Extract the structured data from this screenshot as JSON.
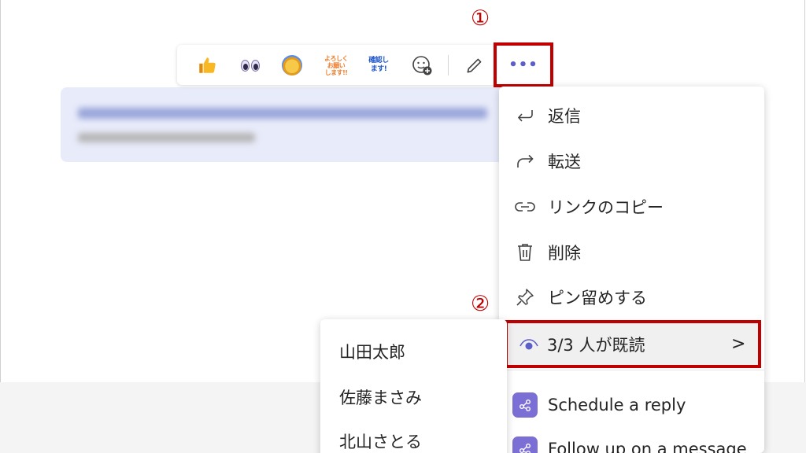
{
  "annotations": {
    "step1": "①",
    "step2": "②"
  },
  "reactions": {
    "thumb_icon": "thumbs-up-icon",
    "eyes_icon": "eyes-icon",
    "lion_icon": "lion-icon",
    "sticker_yoroshiku": "よろしく お願い します!!",
    "sticker_kakunin": "確認し ます!",
    "add_icon": "add-reaction-icon",
    "edit_icon": "pencil-icon",
    "more_label": "•••"
  },
  "menu": {
    "items": [
      {
        "icon": "reply-icon",
        "label": "返信"
      },
      {
        "icon": "forward-icon",
        "label": "転送"
      },
      {
        "icon": "link-icon",
        "label": "リンクのコピー"
      },
      {
        "icon": "trash-icon",
        "label": "削除"
      },
      {
        "icon": "pin-icon",
        "label": "ピン留めする"
      },
      {
        "icon": "eye-icon",
        "label": "3/3 人が既読",
        "chevron": ">"
      }
    ],
    "apps": [
      {
        "icon": "app-icon",
        "label": "Schedule a reply"
      },
      {
        "icon": "app-icon",
        "label": "Follow up on a message"
      }
    ]
  },
  "readers": [
    "山田太郎",
    "佐藤まさみ",
    "北山さとる"
  ],
  "colors": {
    "annotation": "#c00000",
    "accent": "#5b5fc7",
    "bubble": "#e8ebfa",
    "app_icon": "#7b6fd6"
  }
}
